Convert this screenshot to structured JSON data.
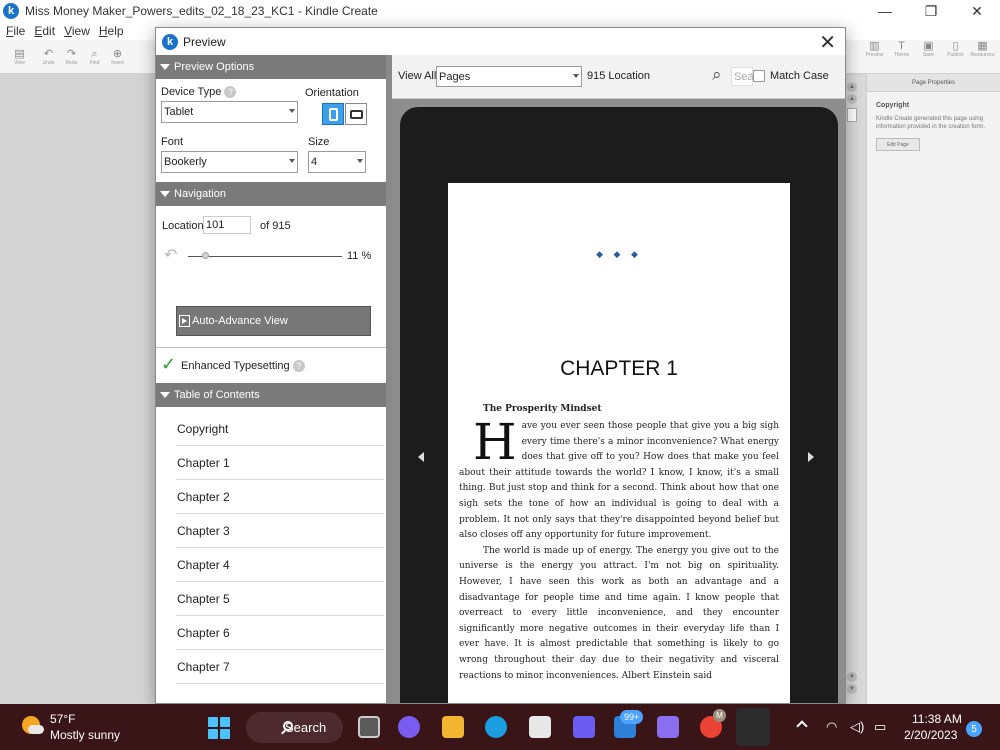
{
  "app": {
    "title": "Miss Money Maker_Powers_edits_02_18_23_KC1 - Kindle Create",
    "logo_letter": "k",
    "menu": [
      "File",
      "Edit",
      "View",
      "Help"
    ],
    "menu_underline": [
      "F",
      "E",
      "V",
      "H"
    ],
    "menu_rest": [
      "ile",
      "dit",
      "iew",
      "elp"
    ],
    "toolbar_left": [
      {
        "icon": "view-icon",
        "glyph": "▤",
        "label": "View"
      },
      {
        "icon": "undo-icon",
        "glyph": "↶",
        "label": "Undo"
      },
      {
        "icon": "redo-icon",
        "glyph": "↷",
        "label": "Redo"
      },
      {
        "icon": "find-icon",
        "glyph": "⌕",
        "label": "Find"
      },
      {
        "icon": "insert-icon",
        "glyph": "⊕",
        "label": "Insert"
      }
    ],
    "toolbar_right": [
      {
        "icon": "preview-icon",
        "glyph": "▥",
        "label": "Preview"
      },
      {
        "icon": "theme-icon",
        "glyph": "T",
        "label": "Theme"
      },
      {
        "icon": "save-icon",
        "glyph": "▣",
        "label": "Save"
      },
      {
        "icon": "publish-icon",
        "glyph": "▯",
        "label": "Publish"
      },
      {
        "icon": "resources-icon",
        "glyph": "▦",
        "label": "Resources"
      }
    ]
  },
  "properties": {
    "header": "Page Properties",
    "title": "Copyright",
    "text": "Kindle Create generated this page using information provided in the creation form.",
    "button": "Edit Page"
  },
  "preview": {
    "title": "Preview",
    "options_header": "Preview Options",
    "device_type_label": "Device Type",
    "device_type_value": "Tablet",
    "orientation_label": "Orientation",
    "font_label": "Font",
    "font_value": "Bookerly",
    "size_label": "Size",
    "size_value": "4",
    "navigation_header": "Navigation",
    "location_label": "Location",
    "location_value": "101",
    "location_of": "of 915",
    "progress_percent_text": "11 %",
    "progress_fraction": 0.11,
    "auto_advance": "Auto-Advance View",
    "enhanced_typesetting": "Enhanced Typesetting",
    "toc_header": "Table of Contents",
    "toc": [
      "Copyright",
      "Chapter 1",
      "Chapter 2",
      "Chapter 3",
      "Chapter 4",
      "Chapter 5",
      "Chapter 6",
      "Chapter 7"
    ],
    "view_all_label": "View All",
    "view_all_value": "Pages",
    "location_count": "915 Location",
    "search_placeholder": "Sear",
    "match_case": "Match Case"
  },
  "book_page": {
    "ornament": "◆ ◆ ◆",
    "chapter_title": "CHAPTER 1",
    "section_heading": "The Prosperity Mindset",
    "drop_cap": "H",
    "paragraph1": "ave you ever seen those people that give you a big sigh every time there's a minor inconvenience? What energy does that give off to you? How does that make you feel about their attitude towards the world? I know, I know, it's a small thing. But just stop and think for a second. Think about how that one sigh sets the tone of how an individual is going to deal with a problem. It not only says that they're disappointed beyond belief but also closes off any opportunity for future improvement.",
    "paragraph2": "The world is made up of energy. The energy you give out to the universe is the energy you attract. I'm not big on spirituality. However, I have seen this work as both an advantage and a disadvantage for people time and time again. I know people that overreact to every little inconvenience, and they encounter significantly more negative outcomes in their everyday life than I ever have. It is almost predictable that something is likely to go wrong throughout their day due to their negativity and visceral reactions to minor inconveniences. Albert Einstein said"
  },
  "taskbar": {
    "temperature": "57°F",
    "weather": "Mostly sunny",
    "search": "Search",
    "mail_badge": "99+",
    "avatar_letter": "M",
    "time": "11:38 AM",
    "date": "2/20/2023",
    "notifications": "5",
    "colors": {
      "background": "#3a1518",
      "accent": "#4cc2ff"
    }
  },
  "colors": {
    "kindle_blue": "#1a73c9",
    "section_header": "#7a7a7a",
    "tablet_bezel": "#1c1c1c",
    "ornament": "#2a5d9b",
    "check": "#2ba42b"
  }
}
